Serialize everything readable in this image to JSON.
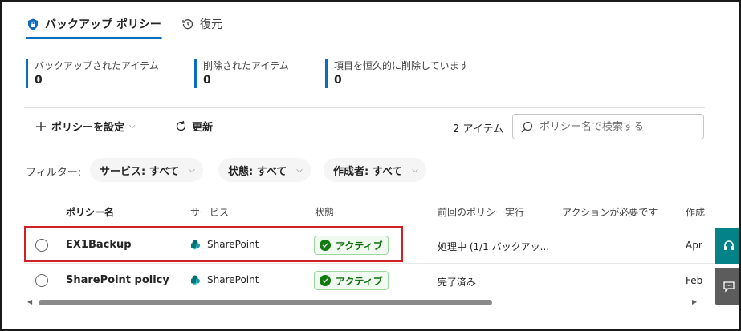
{
  "tabs": {
    "backup_policy": "バックアップ ポリシー",
    "restore": "復元"
  },
  "stats": [
    {
      "label": "バックアップされたアイテム",
      "value": "0"
    },
    {
      "label": "削除されたアイテム",
      "value": "0"
    },
    {
      "label": "項目を恒久的に削除しています",
      "value": "0"
    }
  ],
  "toolbar": {
    "set_policy": "ポリシーを設定",
    "refresh": "更新",
    "item_count": "2 アイテム",
    "search_placeholder": "ポリシー名で検索する"
  },
  "filters": {
    "label": "フィルター:",
    "service": "サービス: すべて",
    "status": "状態: すべて",
    "creator": "作成者: すべて"
  },
  "table": {
    "headers": {
      "policy_name": "ポリシー名",
      "service": "サービス",
      "status": "状態",
      "last_run": "前回のポリシー実行",
      "action_required": "アクションが必要です",
      "created": "作成"
    },
    "rows": [
      {
        "name": "EX1Backup",
        "service": "SharePoint",
        "status": "アクティブ",
        "last_run": "処理中 (1/1 バックアッ...",
        "created": "Apr"
      },
      {
        "name": "SharePoint policy",
        "service": "SharePoint",
        "status": "アクティブ",
        "last_run": "完了済み",
        "created": "Feb"
      }
    ]
  },
  "colors": {
    "accent": "#0f6cbd",
    "active_green": "#107c10",
    "highlight_red": "#d32027",
    "side_teal": "#038387",
    "side_gray": "#5c5c5c"
  },
  "icons": {
    "backup_policy_tab": "shield-lock-icon",
    "restore_tab": "history-icon",
    "set_policy": "plus-icon",
    "refresh": "refresh-icon",
    "search": "search-icon",
    "service": "sharepoint-icon",
    "status": "check-circle-icon",
    "side_top": "headset-icon",
    "side_bottom": "feedback-icon"
  }
}
